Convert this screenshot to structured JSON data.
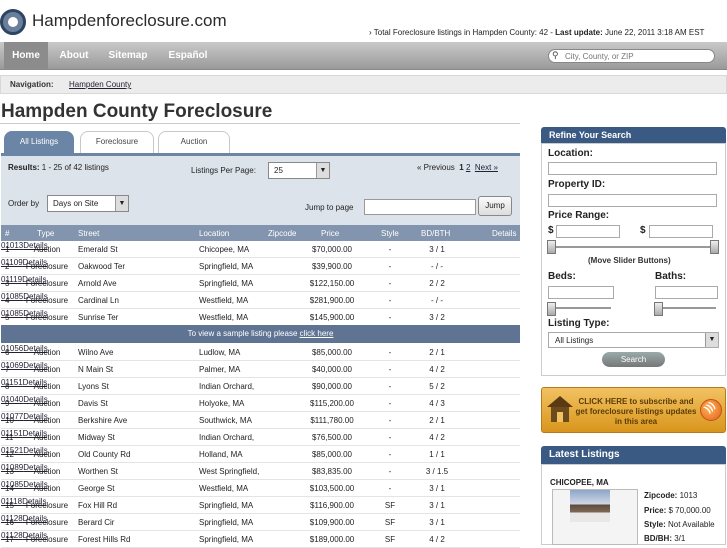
{
  "header": {
    "site_name": "Hampdenforeclosure.com",
    "total_text": "› Total Foreclosure listings in Hampden County: 42 - ",
    "last_update_label": "Last update:",
    "last_update_value": " June 22, 2011 3:18 AM EST"
  },
  "nav": {
    "home": "Home",
    "about": "About",
    "sitemap": "Sitemap",
    "espanol": "Español",
    "search_placeholder": "City, County, or ZIP"
  },
  "breadcrumb": {
    "label": "Navigation:",
    "link": "Hampden County"
  },
  "page_title": "Hampden County Foreclosure",
  "tabs": [
    "All Listings",
    "Foreclosure",
    "Auction"
  ],
  "controls": {
    "results_label": "Results:",
    "results_value": " 1 - 25 of 42 listings",
    "lpp_label": "Listings Per Page:",
    "lpp_value": "25",
    "pager_prev": "« Previous",
    "pager_current": "1",
    "pager_page2": "2",
    "pager_next": "Next »",
    "orderby_label": "Order by",
    "orderby_value": "Days on Site",
    "jump_label": "Jump to page",
    "jump_button": "Jump"
  },
  "table": {
    "headers": [
      "#",
      "Type",
      "Street",
      "Location",
      "Zipcode",
      "Price",
      "Style",
      "BD/BTH",
      "Details"
    ],
    "rows_a": [
      {
        "n": "1",
        "type": "Auction",
        "street": "Emerald St",
        "loc": "Chicopee, MA",
        "zip": "01013",
        "price": "$70,000.00",
        "style": "-",
        "bd": "3 / 1",
        "det": "Details"
      },
      {
        "n": "2",
        "type": "Foreclosure",
        "street": "Oakwood Ter",
        "loc": "Springfield, MA",
        "zip": "01109",
        "price": "$39,900.00",
        "style": "-",
        "bd": "- / -",
        "det": "Details"
      },
      {
        "n": "3",
        "type": "Foreclosure",
        "street": "Arnold Ave",
        "loc": "Springfield, MA",
        "zip": "01119",
        "price": "$122,150.00",
        "style": "-",
        "bd": "2 / 2",
        "det": "Details"
      },
      {
        "n": "4",
        "type": "Foreclosure",
        "street": "Cardinal Ln",
        "loc": "Westfield, MA",
        "zip": "01085",
        "price": "$281,900.00",
        "style": "-",
        "bd": "- / -",
        "det": "Details"
      },
      {
        "n": "5",
        "type": "Foreclosure",
        "street": "Sunrise Ter",
        "loc": "Westfield, MA",
        "zip": "01085",
        "price": "$145,900.00",
        "style": "-",
        "bd": "3 / 2",
        "det": "Details"
      }
    ],
    "banner_text": "To view a sample listing please ",
    "banner_link": "click here",
    "rows_b": [
      {
        "n": "6",
        "type": "Auction",
        "street": "Wilno Ave",
        "loc": "Ludlow, MA",
        "zip": "01056",
        "price": "$85,000.00",
        "style": "-",
        "bd": "2 / 1",
        "det": "Details"
      },
      {
        "n": "7",
        "type": "Auction",
        "street": "N Main St",
        "loc": "Palmer, MA",
        "zip": "01069",
        "price": "$40,000.00",
        "style": "-",
        "bd": "4 / 2",
        "det": "Details"
      },
      {
        "n": "8",
        "type": "Auction",
        "street": "Lyons St",
        "loc": "Indian Orchard,",
        "zip": "01151",
        "price": "$90,000.00",
        "style": "-",
        "bd": "5 / 2",
        "det": "Details"
      },
      {
        "n": "9",
        "type": "Auction",
        "street": "Davis St",
        "loc": "Holyoke, MA",
        "zip": "01040",
        "price": "$115,200.00",
        "style": "-",
        "bd": "4 / 3",
        "det": "Details"
      },
      {
        "n": "10",
        "type": "Auction",
        "street": "Berkshire Ave",
        "loc": "Southwick, MA",
        "zip": "01077",
        "price": "$111,780.00",
        "style": "-",
        "bd": "2 / 1",
        "det": "Details"
      },
      {
        "n": "11",
        "type": "Auction",
        "street": "Midway St",
        "loc": "Indian Orchard,",
        "zip": "01151",
        "price": "$76,500.00",
        "style": "-",
        "bd": "4 / 2",
        "det": "Details"
      },
      {
        "n": "12",
        "type": "Auction",
        "street": "Old County Rd",
        "loc": "Holland, MA",
        "zip": "01521",
        "price": "$85,000.00",
        "style": "-",
        "bd": "1 / 1",
        "det": "Details"
      },
      {
        "n": "13",
        "type": "Auction",
        "street": "Worthen St",
        "loc": "West Springfield,",
        "zip": "01089",
        "price": "$83,835.00",
        "style": "-",
        "bd": "3 / 1.5",
        "det": "Details"
      },
      {
        "n": "14",
        "type": "Auction",
        "street": "George St",
        "loc": "Westfield, MA",
        "zip": "01085",
        "price": "$103,500.00",
        "style": "-",
        "bd": "3 / 1",
        "det": "Details"
      },
      {
        "n": "15",
        "type": "Foreclosure",
        "street": "Fox Hill Rd",
        "loc": "Springfield, MA",
        "zip": "01118",
        "price": "$116,900.00",
        "style": "SF",
        "bd": "3 / 1",
        "det": "Details"
      },
      {
        "n": "16",
        "type": "Foreclosure",
        "street": "Berard Cir",
        "loc": "Springfield, MA",
        "zip": "01128",
        "price": "$109,900.00",
        "style": "SF",
        "bd": "3 / 1",
        "det": "Details"
      },
      {
        "n": "17",
        "type": "Foreclosure",
        "street": "Forest Hills Rd",
        "loc": "Springfield, MA",
        "zip": "01128",
        "price": "$189,000.00",
        "style": "SF",
        "bd": "4 / 2",
        "det": "Details"
      }
    ]
  },
  "refine": {
    "title": "Refine Your Search",
    "location": "Location:",
    "property_id": "Property ID:",
    "price_range": "Price Range:",
    "dollar": "$",
    "slider_note": "(Move Slider Buttons)",
    "beds": "Beds:",
    "baths": "Baths:",
    "listing_type": "Listing Type:",
    "listing_type_value": "All Listings",
    "search_button": "Search"
  },
  "subscribe": {
    "text": "CLICK HERE to subscribe and get foreclosure listings updates in this area"
  },
  "latest": {
    "title": "Latest Listings",
    "city": "CHICOPEE, MA",
    "zip_label": "Zipcode:",
    "zip_value": " 1013",
    "price_label": "Price:",
    "price_value": " $ 70,000.00",
    "style_label": "Style:",
    "style_value": " Not Available",
    "bdbh_label": "BD/BH:",
    "bdbh_value": " 3/1"
  },
  "colors": {
    "nav_gradient_top": "#c9c9c9",
    "header_blue": "#3a5a84",
    "table_header": "#8294ae",
    "subscribe_orange": "#f2c262"
  }
}
